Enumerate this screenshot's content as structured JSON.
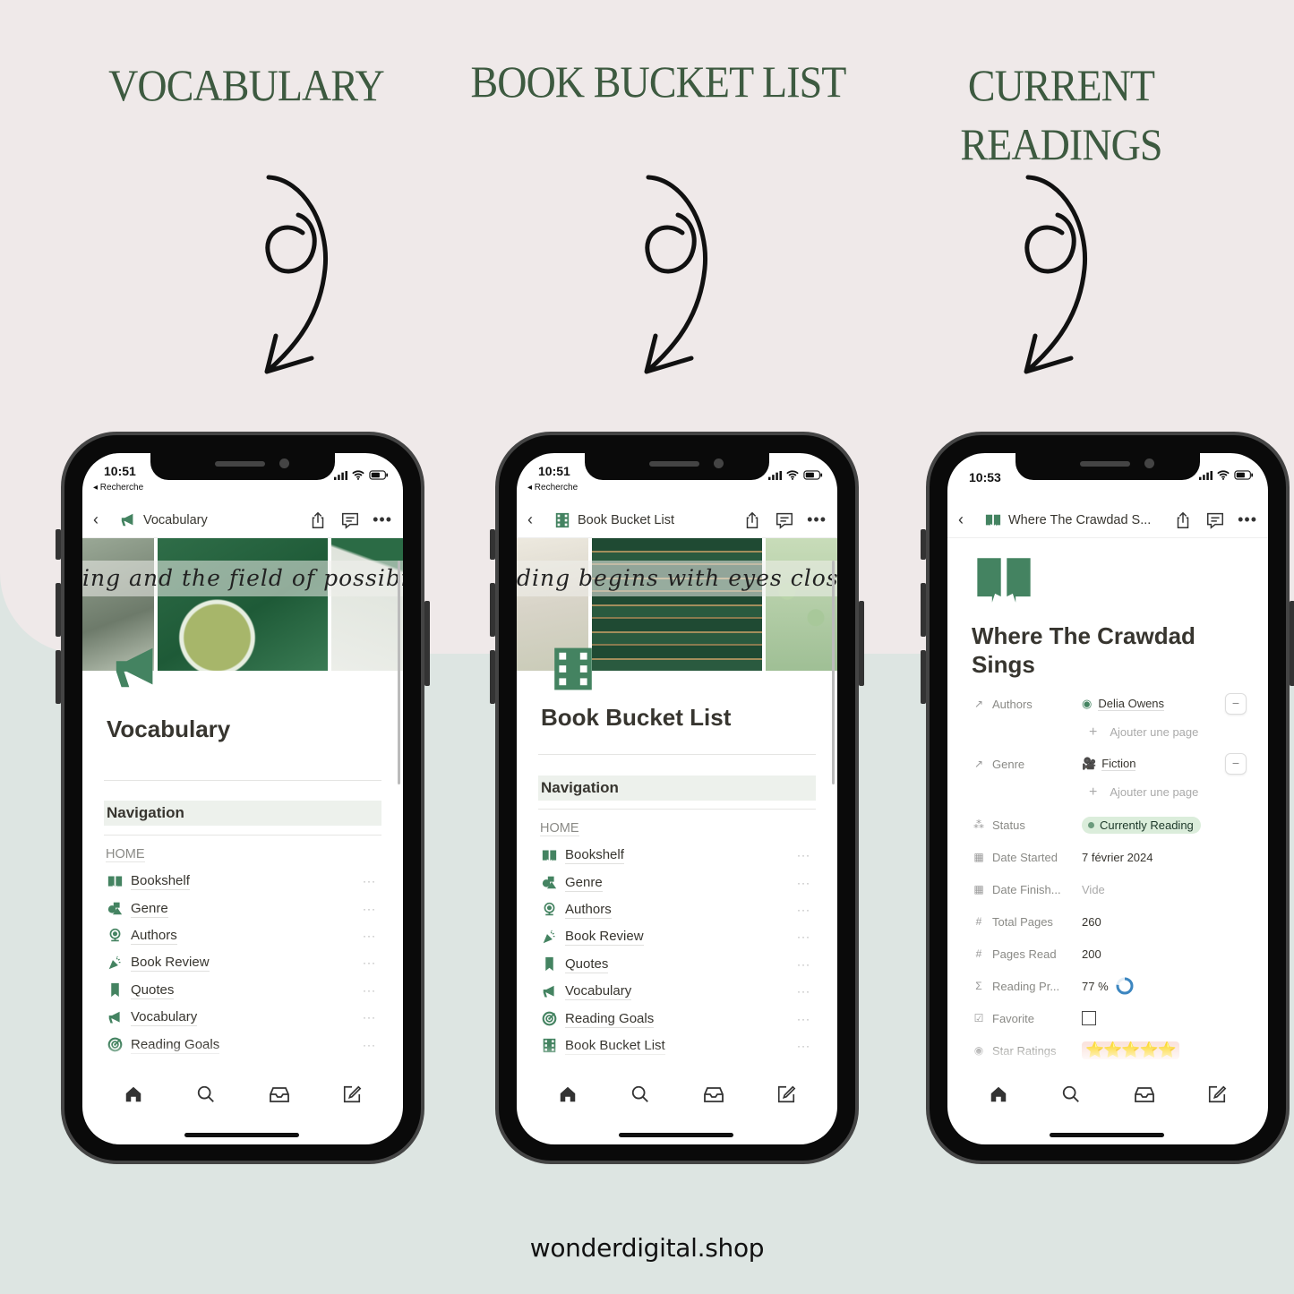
{
  "headings": {
    "vocabulary": "VOCABULARY",
    "bucket": "BOOK BUCKET LIST",
    "current_line1": "CURRENT",
    "current_line2": "READINGS"
  },
  "footer": "wonderdigital.shop",
  "colors": {
    "accent_green": "#448361",
    "heading_green": "#3d5a40",
    "top_bg": "#efe9e9",
    "bottom_bg": "#dde5e2"
  },
  "phones": [
    {
      "time": "10:51",
      "back_app": "◂ Recherche",
      "nav_title": "Vocabulary",
      "nav_icon": "megaphone-icon",
      "cover_quote": "ing and the field of possibility",
      "page_title": "Vocabulary",
      "callout": "Navigation",
      "home_label": "HOME",
      "items": [
        {
          "label": "Bookshelf",
          "icon": "book-open-icon"
        },
        {
          "label": "Genre",
          "icon": "shapes-icon"
        },
        {
          "label": "Authors",
          "icon": "globe-icon"
        },
        {
          "label": "Book Review",
          "icon": "party-popper-icon"
        },
        {
          "label": "Quotes",
          "icon": "bookmark-icon"
        },
        {
          "label": "Vocabulary",
          "icon": "megaphone-icon"
        },
        {
          "label": "Reading Goals",
          "icon": "target-icon"
        }
      ],
      "more": "···"
    },
    {
      "time": "10:51",
      "back_app": "◂ Recherche",
      "nav_title": "Book Bucket List",
      "nav_icon": "film-strip-icon",
      "cover_quote": "ding begins with eyes closed",
      "page_title": "Book Bucket List",
      "callout": "Navigation",
      "home_label": "HOME",
      "items": [
        {
          "label": "Bookshelf",
          "icon": "book-open-icon"
        },
        {
          "label": "Genre",
          "icon": "shapes-icon"
        },
        {
          "label": "Authors",
          "icon": "globe-icon"
        },
        {
          "label": "Book Review",
          "icon": "party-popper-icon"
        },
        {
          "label": "Quotes",
          "icon": "bookmark-icon"
        },
        {
          "label": "Vocabulary",
          "icon": "megaphone-icon"
        },
        {
          "label": "Reading Goals",
          "icon": "target-icon"
        },
        {
          "label": "Book Bucket List",
          "icon": "film-strip-icon"
        }
      ],
      "more": "···"
    },
    {
      "time": "10:53",
      "nav_title": "Where The Crawdad S...",
      "nav_icon": "book-open-icon",
      "page_title_line1": "Where The Crawdad",
      "page_title_line2": "Sings",
      "add_page": "Ajouter une page",
      "properties": {
        "authors": {
          "label": "Authors",
          "value": "Delia Owens"
        },
        "genre": {
          "label": "Genre",
          "value": "Fiction"
        },
        "status": {
          "label": "Status",
          "value": "Currently Reading"
        },
        "date_started": {
          "label": "Date Started",
          "value": "7 février 2024"
        },
        "date_finished": {
          "label": "Date Finish...",
          "value": "Vide"
        },
        "total_pages": {
          "label": "Total Pages",
          "value": "260"
        },
        "pages_read": {
          "label": "Pages Read",
          "value": "200"
        },
        "reading_progress": {
          "label": "Reading Pr...",
          "value": "77 %",
          "fraction": 0.77
        },
        "favorite": {
          "label": "Favorite",
          "checked": false
        },
        "star_ratings": {
          "label": "Star Ratings",
          "value": "⭐⭐⭐⭐⭐",
          "stars": 5
        }
      }
    }
  ]
}
